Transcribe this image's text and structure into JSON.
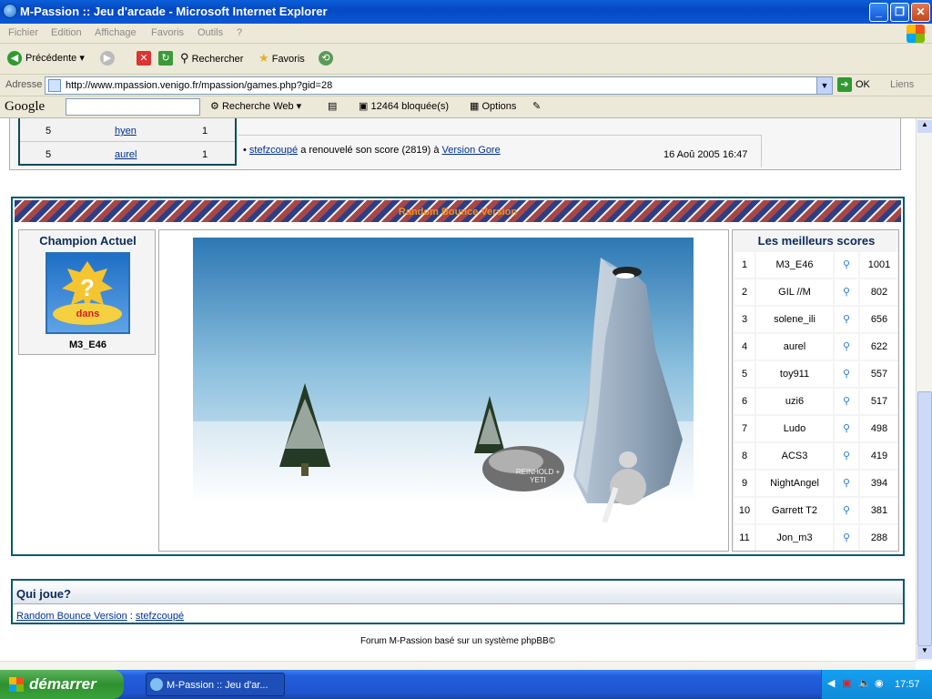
{
  "window": {
    "title": "M-Passion :: Jeu d'arcade - Microsoft Internet Explorer",
    "min": "_",
    "max": "❐",
    "close": "✕"
  },
  "menu": [
    "Fichier",
    "Edition",
    "Affichage",
    "Favoris",
    "Outils",
    "?"
  ],
  "toolbar": {
    "back": "Précédente",
    "search": "Rechercher",
    "favorites": "Favoris"
  },
  "address": {
    "label": "Adresse",
    "url": "http://www.mpassion.venigo.fr/mpassion/games.php?gid=28",
    "go": "OK",
    "links": "Liens"
  },
  "googlebar": {
    "logo": "Google",
    "search_web": "Recherche Web",
    "blocked": "12464 bloquée(s)",
    "options": "Options"
  },
  "ranking_rows": [
    {
      "rank": "5",
      "name": "hyen",
      "count": "1"
    },
    {
      "rank": "5",
      "name": "aurel",
      "count": "1"
    }
  ],
  "news": {
    "user": "stefzcoupé",
    "text": "a renouvelé son score (2819) à",
    "game": "Version Gore",
    "date": "16 Aoû 2005 16:47"
  },
  "game": {
    "title": "Random Bounce Version",
    "rock_text": "REINHOLD + YETI"
  },
  "champion": {
    "heading": "Champion Actuel",
    "image_text": "dans",
    "name": "M3_E46"
  },
  "scores": {
    "heading": "Les meilleurs scores",
    "rows": [
      {
        "rank": "1",
        "name": "M3_E46",
        "score": "1001"
      },
      {
        "rank": "2",
        "name": "GIL //M",
        "score": "802"
      },
      {
        "rank": "3",
        "name": "solene_ili",
        "score": "656"
      },
      {
        "rank": "4",
        "name": "aurel",
        "score": "622"
      },
      {
        "rank": "5",
        "name": "toy911",
        "score": "557"
      },
      {
        "rank": "6",
        "name": "uzi6",
        "score": "517"
      },
      {
        "rank": "7",
        "name": "Ludo",
        "score": "498"
      },
      {
        "rank": "8",
        "name": "ACS3",
        "score": "419"
      },
      {
        "rank": "9",
        "name": "NightAngel",
        "score": "394"
      },
      {
        "rank": "10",
        "name": "Garrett T2",
        "score": "381"
      },
      {
        "rank": "11",
        "name": "Jon_m3",
        "score": "288"
      }
    ]
  },
  "qui_joue": {
    "heading": "Qui joue?",
    "game": "Random Bounce Version",
    "sep": ":",
    "player": "stefzcoupé"
  },
  "footer": "Forum M-Passion basé sur un système phpBB©",
  "taskbar": {
    "start": "démarrer",
    "task": "M-Passion :: Jeu d'ar...",
    "clock": "17:57"
  },
  "colors": {
    "title_blue": "#0548c2",
    "header_orange": "#f28f24",
    "panel_border": "#0a5a6a",
    "start_green": "#2e902e"
  }
}
